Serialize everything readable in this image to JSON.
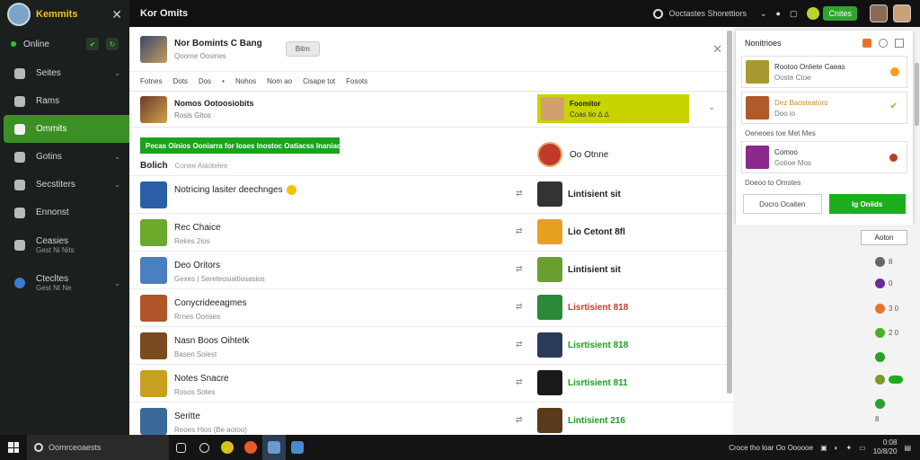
{
  "sidebar": {
    "brand": "Kemmits",
    "online_label": "Online",
    "items": [
      {
        "label": "Seites",
        "chevron": true
      },
      {
        "label": "Rams",
        "chevron": false
      },
      {
        "label": "Ommits",
        "chevron": false,
        "active": true
      },
      {
        "label": "Gotins",
        "chevron": true
      },
      {
        "label": "Secstiters",
        "chevron": true
      },
      {
        "label": "Ennonst",
        "chevron": false
      },
      {
        "label": "Ceasies",
        "sub": "Gest Ni Nits",
        "chevron": false
      },
      {
        "label": "Ctecltes",
        "sub": "Gest Nt Ne",
        "chevron": true
      }
    ]
  },
  "topbar": {
    "title": "Kor Omits",
    "search_text": "Ooctastes Shorettiors",
    "green_button": "Cnites"
  },
  "main": {
    "header": {
      "title": "Nor Bomints C Bang",
      "subtitle": "Qoome Oosines",
      "button": "Bitm"
    },
    "tabs": [
      "Fotnes",
      "Dots",
      "Dos",
      "•",
      "Nohos",
      "Nom ao",
      "Cisape tot",
      "Fosots"
    ],
    "featured": {
      "title": "Nomos Ootoosiobits",
      "subtitle": "Rosis Gitos",
      "hl_title": "Foomitor",
      "hl_subtitle": "Coas tio ∆ ∆"
    },
    "banner": "Pecas Oinios Ooniarra for Ioaes Inostoc Oatiacss Inaniaos",
    "list_title": "Bolich",
    "list_subtitle": "Conee Aiaotelee",
    "right_title": "Oo Otnne",
    "rows": [
      {
        "name": "Notricing lasiter deechnges",
        "sub": "",
        "right": "Lintisient sit",
        "rcolor": "#222",
        "thumb": "#2a5fa8",
        "rthumb": "#333"
      },
      {
        "name": "Rec Chaice",
        "sub": "Rekes 2ios",
        "right": "Lio Cetont 8fl",
        "rcolor": "#222",
        "thumb": "#6aa92a",
        "rthumb": "#e8a020"
      },
      {
        "name": "Deo Oritors",
        "sub": "Gexes | Sereteosiaitiosasios",
        "right": "Lintisient sit",
        "rcolor": "#222",
        "thumb": "#4a7fc0",
        "rthumb": "#6a9f30"
      },
      {
        "name": "Conycrideeagmes",
        "sub": "Rrnes Oorises",
        "right": "Lisrtisient 818",
        "rcolor": "#d03a2a",
        "thumb": "#b0552a",
        "rthumb": "#2a8a3a"
      },
      {
        "name": "Nasn Boos Oihtetk",
        "sub": "Basen Soiest",
        "right": "Lisrtisient 818",
        "rcolor": "#1aa01a",
        "thumb": "#7a4a20",
        "rthumb": "#2a3a5a"
      },
      {
        "name": "Notes Snacre",
        "sub": "Rosos Sotes",
        "right": "Lisrtisient 811",
        "rcolor": "#1aa01a",
        "thumb": "#c8a020",
        "rthumb": "#1a1a1a"
      },
      {
        "name": "Seritte",
        "sub": "Reoes Hios (Be aotoo)",
        "right": "Lintisient 216",
        "rcolor": "#1aa01a",
        "thumb": "#3a6a9a",
        "rthumb": "#5a3a1a"
      }
    ]
  },
  "notifications": {
    "title": "Nonitrioes",
    "cards": [
      {
        "title": "Rootoo Onliete Caeas",
        "sub": "Ooste Ctoe",
        "thumb": "#a89a30"
      },
      {
        "title": "Dez Baosteatoro",
        "sub": "Doo io",
        "thumb": "#b05a2a",
        "title_color": "#c0902a"
      }
    ],
    "section1": "Oeneoes toe Met Mes",
    "card3": {
      "title": "Comoo",
      "sub": "Gotioe Mos"
    },
    "section2": "Doeoo to Omstes",
    "btn_secondary": "Docro Ocaiten",
    "btn_primary": "Ig Oniids"
  },
  "rightcol": {
    "button": "Aoton",
    "rows": [
      "8",
      "0",
      "3 0",
      "2 0",
      "",
      "8"
    ]
  },
  "taskbar": {
    "search": "Oomrceoaests",
    "tray_text": "Croce tho loar Oo Oooooe",
    "time": "0:08",
    "date": "10/8/20"
  }
}
